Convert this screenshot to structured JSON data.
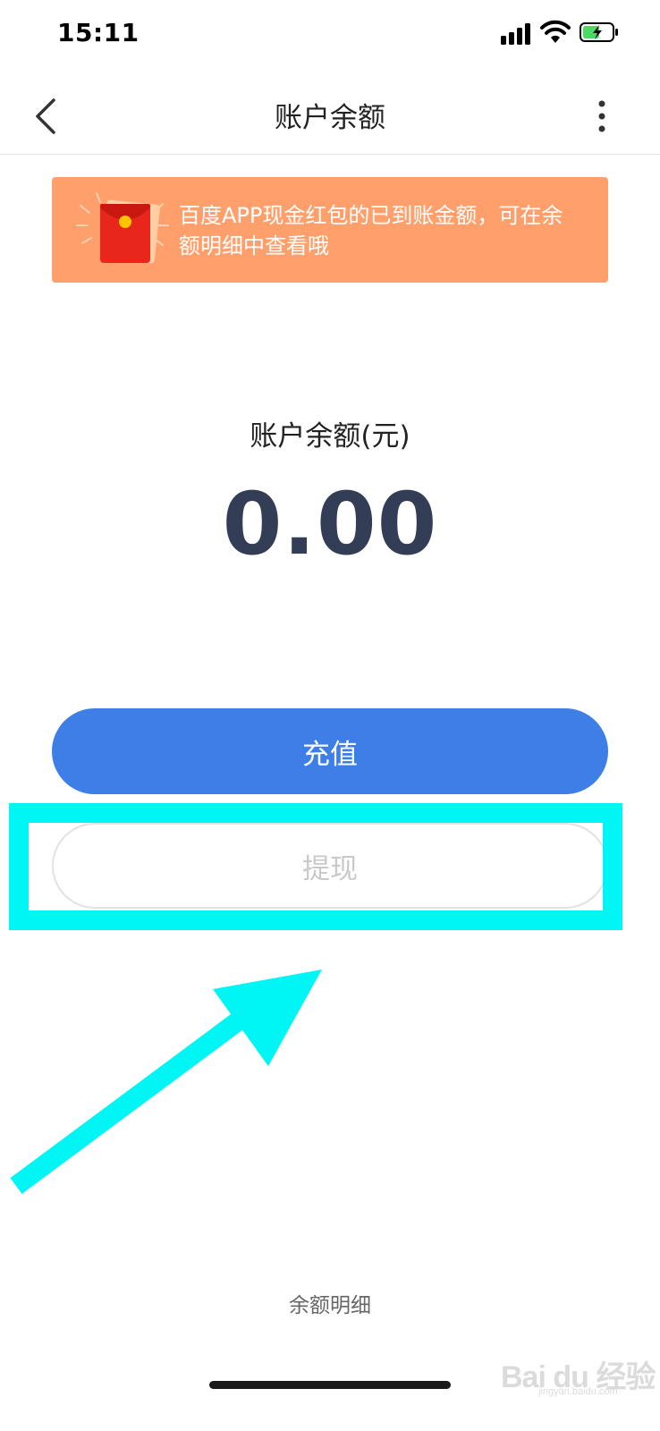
{
  "status_bar": {
    "time": "15:11"
  },
  "header": {
    "title": "账户余额"
  },
  "notice": {
    "text": "百度APP现金红包的已到账金额，可在余额明细中查看哦"
  },
  "balance": {
    "label": "账户余额(元)",
    "value": "0.00"
  },
  "buttons": {
    "recharge": "充值",
    "withdraw": "提现"
  },
  "footer": {
    "detail_link": "余额明细"
  },
  "watermark": {
    "logo_text": "Bai du 经验",
    "url": "jingyan.baidu.com"
  },
  "colors": {
    "primary_blue": "#3d7ee7",
    "banner_orange": "#ff9f6b",
    "balance_text": "#333d56",
    "highlight_cyan": "#00f5f5"
  },
  "icons": [
    "back-icon",
    "more-icon",
    "red-envelope-icon",
    "signal-icon",
    "wifi-icon",
    "battery-icon"
  ]
}
